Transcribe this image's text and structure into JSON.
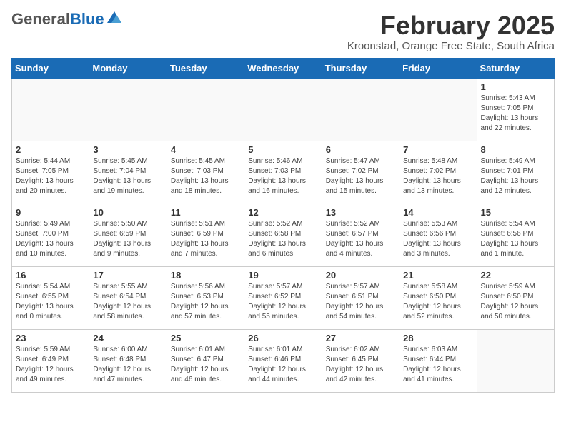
{
  "header": {
    "logo_general": "General",
    "logo_blue": "Blue",
    "month_title": "February 2025",
    "location": "Kroonstad, Orange Free State, South Africa"
  },
  "days_of_week": [
    "Sunday",
    "Monday",
    "Tuesday",
    "Wednesday",
    "Thursday",
    "Friday",
    "Saturday"
  ],
  "weeks": [
    [
      {
        "day": "",
        "info": ""
      },
      {
        "day": "",
        "info": ""
      },
      {
        "day": "",
        "info": ""
      },
      {
        "day": "",
        "info": ""
      },
      {
        "day": "",
        "info": ""
      },
      {
        "day": "",
        "info": ""
      },
      {
        "day": "1",
        "info": "Sunrise: 5:43 AM\nSunset: 7:05 PM\nDaylight: 13 hours\nand 22 minutes."
      }
    ],
    [
      {
        "day": "2",
        "info": "Sunrise: 5:44 AM\nSunset: 7:05 PM\nDaylight: 13 hours\nand 20 minutes."
      },
      {
        "day": "3",
        "info": "Sunrise: 5:45 AM\nSunset: 7:04 PM\nDaylight: 13 hours\nand 19 minutes."
      },
      {
        "day": "4",
        "info": "Sunrise: 5:45 AM\nSunset: 7:03 PM\nDaylight: 13 hours\nand 18 minutes."
      },
      {
        "day": "5",
        "info": "Sunrise: 5:46 AM\nSunset: 7:03 PM\nDaylight: 13 hours\nand 16 minutes."
      },
      {
        "day": "6",
        "info": "Sunrise: 5:47 AM\nSunset: 7:02 PM\nDaylight: 13 hours\nand 15 minutes."
      },
      {
        "day": "7",
        "info": "Sunrise: 5:48 AM\nSunset: 7:02 PM\nDaylight: 13 hours\nand 13 minutes."
      },
      {
        "day": "8",
        "info": "Sunrise: 5:49 AM\nSunset: 7:01 PM\nDaylight: 13 hours\nand 12 minutes."
      }
    ],
    [
      {
        "day": "9",
        "info": "Sunrise: 5:49 AM\nSunset: 7:00 PM\nDaylight: 13 hours\nand 10 minutes."
      },
      {
        "day": "10",
        "info": "Sunrise: 5:50 AM\nSunset: 6:59 PM\nDaylight: 13 hours\nand 9 minutes."
      },
      {
        "day": "11",
        "info": "Sunrise: 5:51 AM\nSunset: 6:59 PM\nDaylight: 13 hours\nand 7 minutes."
      },
      {
        "day": "12",
        "info": "Sunrise: 5:52 AM\nSunset: 6:58 PM\nDaylight: 13 hours\nand 6 minutes."
      },
      {
        "day": "13",
        "info": "Sunrise: 5:52 AM\nSunset: 6:57 PM\nDaylight: 13 hours\nand 4 minutes."
      },
      {
        "day": "14",
        "info": "Sunrise: 5:53 AM\nSunset: 6:56 PM\nDaylight: 13 hours\nand 3 minutes."
      },
      {
        "day": "15",
        "info": "Sunrise: 5:54 AM\nSunset: 6:56 PM\nDaylight: 13 hours\nand 1 minute."
      }
    ],
    [
      {
        "day": "16",
        "info": "Sunrise: 5:54 AM\nSunset: 6:55 PM\nDaylight: 13 hours\nand 0 minutes."
      },
      {
        "day": "17",
        "info": "Sunrise: 5:55 AM\nSunset: 6:54 PM\nDaylight: 12 hours\nand 58 minutes."
      },
      {
        "day": "18",
        "info": "Sunrise: 5:56 AM\nSunset: 6:53 PM\nDaylight: 12 hours\nand 57 minutes."
      },
      {
        "day": "19",
        "info": "Sunrise: 5:57 AM\nSunset: 6:52 PM\nDaylight: 12 hours\nand 55 minutes."
      },
      {
        "day": "20",
        "info": "Sunrise: 5:57 AM\nSunset: 6:51 PM\nDaylight: 12 hours\nand 54 minutes."
      },
      {
        "day": "21",
        "info": "Sunrise: 5:58 AM\nSunset: 6:50 PM\nDaylight: 12 hours\nand 52 minutes."
      },
      {
        "day": "22",
        "info": "Sunrise: 5:59 AM\nSunset: 6:50 PM\nDaylight: 12 hours\nand 50 minutes."
      }
    ],
    [
      {
        "day": "23",
        "info": "Sunrise: 5:59 AM\nSunset: 6:49 PM\nDaylight: 12 hours\nand 49 minutes."
      },
      {
        "day": "24",
        "info": "Sunrise: 6:00 AM\nSunset: 6:48 PM\nDaylight: 12 hours\nand 47 minutes."
      },
      {
        "day": "25",
        "info": "Sunrise: 6:01 AM\nSunset: 6:47 PM\nDaylight: 12 hours\nand 46 minutes."
      },
      {
        "day": "26",
        "info": "Sunrise: 6:01 AM\nSunset: 6:46 PM\nDaylight: 12 hours\nand 44 minutes."
      },
      {
        "day": "27",
        "info": "Sunrise: 6:02 AM\nSunset: 6:45 PM\nDaylight: 12 hours\nand 42 minutes."
      },
      {
        "day": "28",
        "info": "Sunrise: 6:03 AM\nSunset: 6:44 PM\nDaylight: 12 hours\nand 41 minutes."
      },
      {
        "day": "",
        "info": ""
      }
    ]
  ]
}
